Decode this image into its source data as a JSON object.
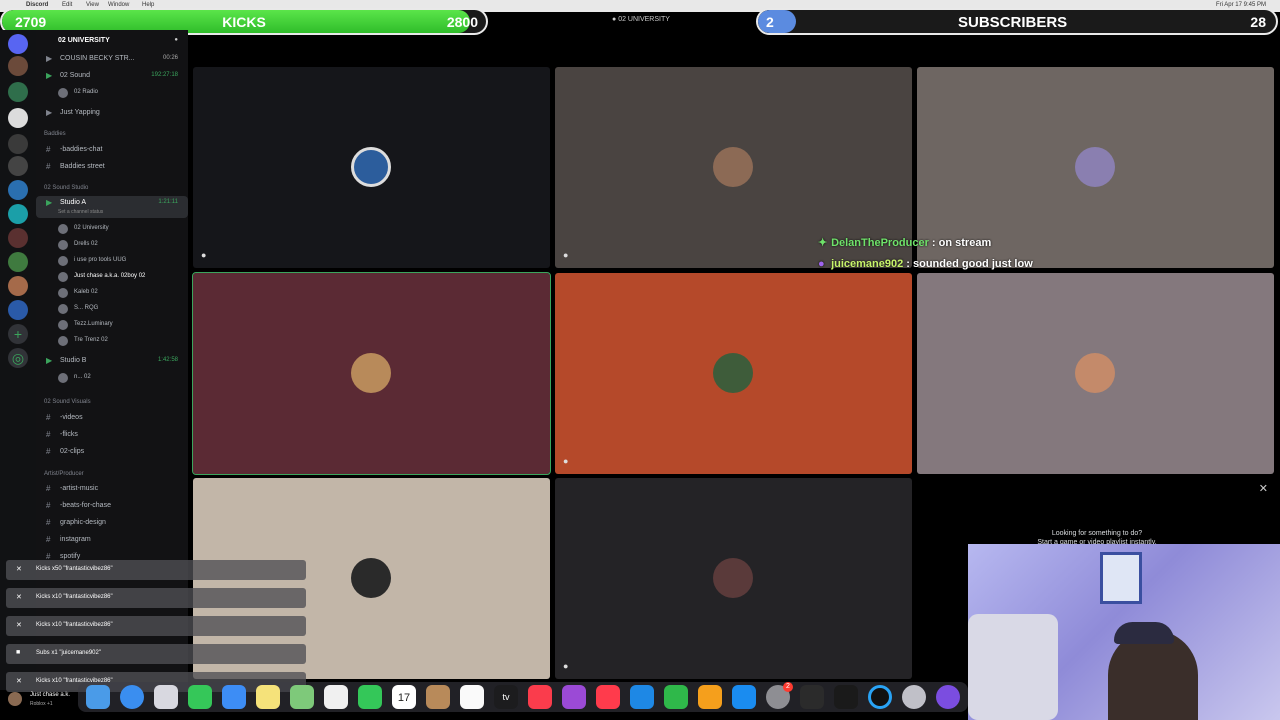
{
  "menubar": {
    "app": "Discord",
    "menus": [
      "Edit",
      "View",
      "Window",
      "Help"
    ],
    "clock": "Fri Apr 17 9:45 PM"
  },
  "goals": {
    "kicks": {
      "label": "KICKS",
      "current": "2709",
      "target": "2800",
      "progress": 0.967
    },
    "subscribers": {
      "label": "SUBSCRIBERS",
      "current": "2",
      "target": "28",
      "progress": 0.071
    }
  },
  "top_server_name": "02 UNIVERSITY",
  "sidebar": {
    "server_name": "02 UNIVERSITY",
    "rows": [
      {
        "kind": "voice",
        "label": "COUSIN BECKY STR...",
        "time": "00:26"
      },
      {
        "kind": "voice",
        "label": "02 Sound",
        "time": "192:27:18"
      },
      {
        "kind": "user",
        "label": "02 Radio"
      },
      {
        "kind": "voice",
        "label": "Just Yapping",
        "time": ""
      },
      {
        "kind": "cat",
        "label": "Baddies"
      },
      {
        "kind": "text",
        "label": "-baddies-chat"
      },
      {
        "kind": "text",
        "label": "Baddies street"
      },
      {
        "kind": "cat",
        "label": "02 Sound Studio"
      },
      {
        "kind": "voice",
        "label": "Studio A",
        "time": "1:21:11",
        "sub": "Set a channel status"
      },
      {
        "kind": "user",
        "label": "02 University"
      },
      {
        "kind": "user",
        "label": "Drells 02"
      },
      {
        "kind": "user",
        "label": "i use pro tools UUG"
      },
      {
        "kind": "user",
        "label": "Just chase a.k.a. 02boy 02"
      },
      {
        "kind": "user",
        "label": "Kaleb 02"
      },
      {
        "kind": "user",
        "label": "S... RQG"
      },
      {
        "kind": "user",
        "label": "Tezz.Luminary"
      },
      {
        "kind": "user",
        "label": "Tre Trenz 02"
      },
      {
        "kind": "voice",
        "label": "Studio B",
        "time": "1:42:58"
      },
      {
        "kind": "user",
        "label": "n... 02"
      },
      {
        "kind": "cat",
        "label": "02 Sound Visuals"
      },
      {
        "kind": "text",
        "label": "-videos"
      },
      {
        "kind": "text",
        "label": "-flicks"
      },
      {
        "kind": "text",
        "label": "02-clips"
      },
      {
        "kind": "cat",
        "label": "Artist/Producer"
      },
      {
        "kind": "text",
        "label": "-artist-music"
      },
      {
        "kind": "text",
        "label": "-beats-for-chase"
      },
      {
        "kind": "text",
        "label": "graphic-design"
      },
      {
        "kind": "text",
        "label": "instagram"
      },
      {
        "kind": "text",
        "label": "spotify"
      }
    ]
  },
  "chat": [
    {
      "user": "DelanTheProducer",
      "message": " : on stream",
      "color": "#6fe26a"
    },
    {
      "user": "juicemane902",
      "message": " : sounded good just low",
      "color": "#c7f36a"
    }
  ],
  "activity": {
    "title": "Looking for something to do?",
    "subtitle": "Start a game or video playlist instantly."
  },
  "alerts": [
    "Kicks x50 \"frantasticvibez86\"",
    "Kicks x10 \"frantasticvibez86\"",
    "Kicks x10 \"frantasticvibez86\"",
    "Subs x1 \"juicemane902\"",
    "Kicks x10 \"frantasticvibez86\""
  ],
  "user_panel": {
    "name": "Just chase a.k.",
    "status": "Roblox +1"
  },
  "dock": {
    "calendar_day": "17",
    "notification_badge": "2"
  },
  "colors": {
    "discord_green": "#3ba55d",
    "kicks_green": "#4fd93f",
    "subs_blue": "#5b8be0"
  }
}
